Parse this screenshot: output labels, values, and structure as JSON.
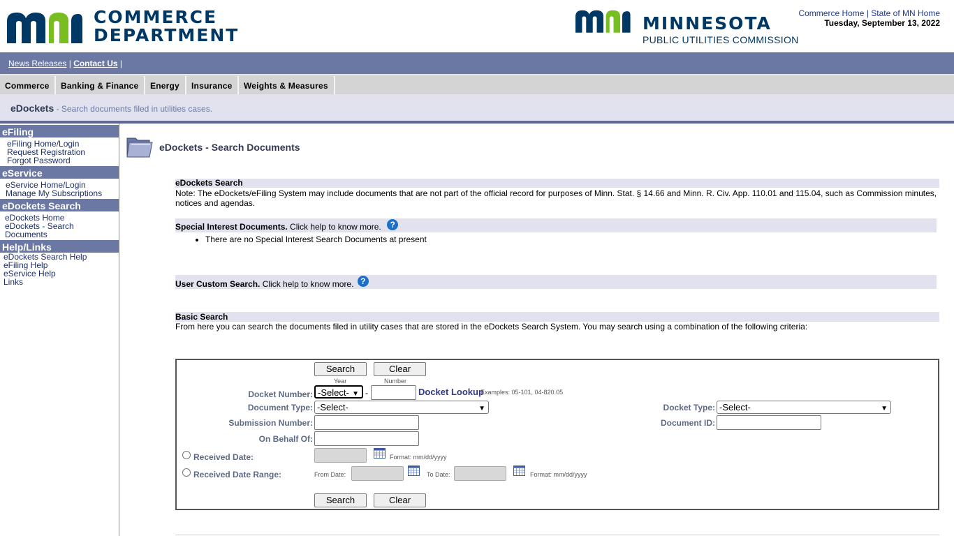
{
  "header": {
    "left_logo": {
      "line1": "COMMERCE",
      "line2": "DEPARTMENT"
    },
    "right_logo": {
      "line1": "MINNESOTA",
      "line2": "PUBLIC UTILITIES COMMISSION"
    },
    "links": [
      "Commerce Home",
      "State of MN Home"
    ],
    "date": "Tuesday, September 13, 2022"
  },
  "topnav": {
    "news": "News Releases",
    "contact": "Contact Us",
    "sep": "|"
  },
  "tabs": [
    "Commerce",
    "Banking & Finance",
    "Energy",
    "Insurance",
    "Weights & Measures"
  ],
  "titlebar": {
    "title": "eDockets",
    "subtitle": " - Search documents filed in utilities cases."
  },
  "sidebar": {
    "efiling": {
      "heading": "eFiling",
      "items": [
        "eFiling Home/Login",
        "Request Registration",
        "Forgot Password"
      ]
    },
    "eservice": {
      "heading": "eService",
      "items": [
        "eService Home/Login",
        "Manage My Subscriptions"
      ]
    },
    "edockets": {
      "heading": "eDockets Search",
      "items": [
        "eDockets Home",
        "eDockets - Search",
        "Documents"
      ]
    },
    "help": {
      "heading": "Help/Links",
      "items": [
        "eDockets Search Help",
        "eFiling Help",
        "eService Help",
        "Links"
      ]
    }
  },
  "main": {
    "title": "eDockets - Search Documents",
    "search_heading": "eDockets Search",
    "note": "Note: The eDockets/eFiling System may include documents that are not part of the official record for purposes of Minn. Stat. § 14.66 and Minn. R. Civ. App. 110.01 and 115.04, such as Commission minutes, notices and agendas.",
    "special_bold": "Special Interest Documents.",
    "special_rest": " Click help to know more.",
    "special_item": "There are no Special Interest Search Documents at present",
    "custom_bold": "User Custom Search.",
    "custom_rest": " Click help to know more.",
    "basic_heading": "Basic Search",
    "basic_text": "From here you can search the documents filed in utility cases that are stored in the eDockets Search System. You may search using a combination of the following criteria:",
    "help_glyph": "?"
  },
  "form": {
    "search_label": "Search",
    "clear_label": "Clear",
    "year_label": "Year",
    "number_label": "Number",
    "docket_number_label": "Docket Number:",
    "year_select": "-Select-",
    "dash": "-",
    "docket_lookup": "Docket Lookup",
    "examples": "Examples: 05-101, 04-820.05",
    "document_type_label": "Document Type:",
    "document_type_select": "-Select-",
    "docket_type_label": "Docket Type:",
    "docket_type_select": "-Select-",
    "submission_number_label": "Submission Number:",
    "document_id_label": "Document ID:",
    "on_behalf_label": "On Behalf Of:",
    "received_date_label": "Received Date:",
    "received_range_label": "Received Date Range:",
    "format_text": "Format: mm/dd/yyyy",
    "from_date": "From Date:",
    "to_date": "To Date:"
  },
  "colors": {
    "nav_blue": "#6b78a4",
    "logo_navy": "#003865",
    "logo_green": "#78be20",
    "band": "#e1e2ee"
  }
}
